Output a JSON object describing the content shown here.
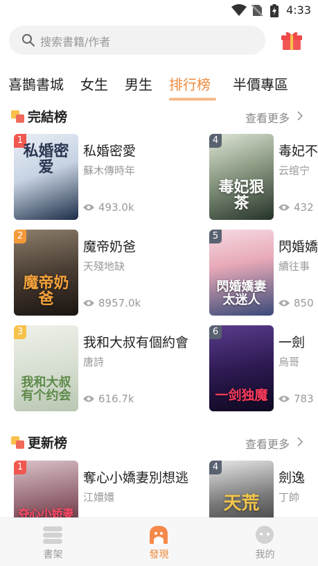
{
  "status_bar": {
    "time": "4:33"
  },
  "search": {
    "placeholder": "搜索書籍/作者"
  },
  "tabs": [
    {
      "label": "喜鵲書城"
    },
    {
      "label": "女生"
    },
    {
      "label": "男生"
    },
    {
      "label": "排行榜",
      "active": true
    },
    {
      "label": "半價專區"
    }
  ],
  "sections": [
    {
      "title": "完結榜",
      "more_label": "查看更多",
      "books": [
        {
          "rank": "1",
          "title": "私婚密愛",
          "author": "蘇木傳時年",
          "views": "493.0k",
          "cover_text": "私婚密爱"
        },
        {
          "rank": "4",
          "title": "毒妃不",
          "author": "云绾宁",
          "views": "432",
          "cover_text": "毒妃狠茶"
        },
        {
          "rank": "2",
          "title": "魔帝奶爸",
          "author": "天殘地缺",
          "views": "8957.0k",
          "cover_text": "魔帝奶爸"
        },
        {
          "rank": "5",
          "title": "閃婚嬌",
          "author": "續往事",
          "views": "850",
          "cover_text": "閃婚嬌妻太迷人"
        },
        {
          "rank": "3",
          "title": "我和大叔有個約會",
          "author": "唐詩",
          "views": "616.7k",
          "cover_text": "我和大叔有个约会"
        },
        {
          "rank": "6",
          "title": "一劍",
          "author": "烏哥",
          "views": "783",
          "cover_text": "一剑独魔"
        }
      ]
    },
    {
      "title": "更新榜",
      "more_label": "查看更多",
      "books": [
        {
          "rank": "1",
          "title": "奪心小嬌妻別想逃",
          "author": "江嬛嬛",
          "views": "",
          "cover_text": "夺心小娇妻"
        },
        {
          "rank": "4",
          "title": "劍逸",
          "author": "丁帥",
          "views": "",
          "cover_text": "天荒"
        }
      ]
    }
  ],
  "bottom_nav": [
    {
      "label": "書架",
      "icon": "bookshelf-icon"
    },
    {
      "label": "發現",
      "icon": "discover-icon",
      "active": true
    },
    {
      "label": "我的",
      "icon": "profile-icon"
    }
  ],
  "colors": {
    "accent": "#f08a3c",
    "rank1": "#f0574f",
    "rank2": "#f59a3b",
    "rank3": "#f7c14a",
    "rank_other": "#596270"
  }
}
